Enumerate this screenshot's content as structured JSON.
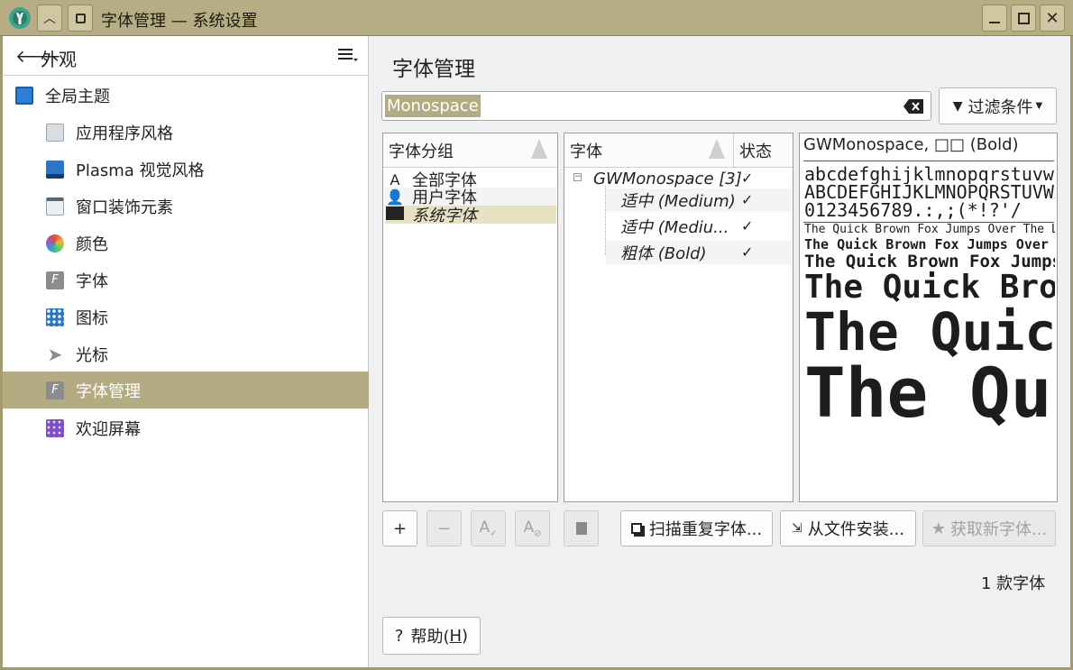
{
  "window": {
    "title": "字体管理 — 系统设置"
  },
  "sidebar": {
    "header": "外观",
    "items": [
      {
        "label": "全局主题",
        "icon": "global-theme-icon"
      },
      {
        "label": "应用程序风格",
        "icon": "app-style-icon"
      },
      {
        "label": "Plasma 视觉风格",
        "icon": "plasma-style-icon"
      },
      {
        "label": "窗口装饰元素",
        "icon": "window-decoration-icon"
      },
      {
        "label": "颜色",
        "icon": "colors-icon"
      },
      {
        "label": "字体",
        "icon": "fonts-icon"
      },
      {
        "label": "图标",
        "icon": "icons-icon"
      },
      {
        "label": "光标",
        "icon": "cursor-icon"
      },
      {
        "label": "字体管理",
        "icon": "font-management-icon"
      },
      {
        "label": "欢迎屏幕",
        "icon": "splash-screen-icon"
      }
    ]
  },
  "main": {
    "title": "字体管理",
    "search": {
      "value": "Monospace"
    },
    "filter_label": "过滤条件",
    "groups": {
      "header": "字体分组",
      "items": [
        "全部字体",
        "用户字体",
        "系统字体"
      ]
    },
    "fonts": {
      "header": "字体",
      "status_header": "状态",
      "family": "GWMonospace [3]",
      "styles": [
        "适中 (Medium)",
        "适中 (Mediu...",
        "粗体 (Bold)"
      ]
    },
    "preview": {
      "title": "GWMonospace, □□ (Bold)",
      "lower": "abcdefghijklmnopqrstuvwxyz",
      "upper": "ABCDEFGHIJKLMNOPQRSTUVWXYZ",
      "digits": "0123456789.:,;(*!?'/",
      "sample": "The Quick Brown Fox Jumps Over The Lazy Dog"
    },
    "toolbar": {
      "add": "+",
      "remove": "−",
      "scan_label": "扫描重复字体...",
      "install_label": "从文件安装...",
      "get_new_label": "获取新字体..."
    },
    "count_text": "1 款字体",
    "help_label": "帮助(",
    "help_key": "H",
    "help_end": ")"
  },
  "colors": {
    "accent": "#b5ab82",
    "titlebar": "#b6ad85"
  }
}
